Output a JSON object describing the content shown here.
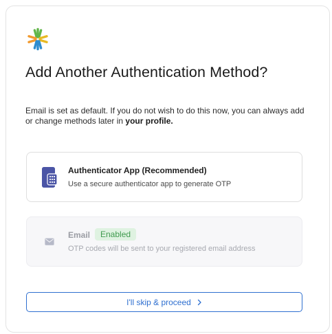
{
  "dialog": {
    "title": "Add Another Authentication Method?",
    "description_prefix": "Email is set as default. If you do not wish to do this now, you can always add or change methods later in ",
    "description_link": "your profile."
  },
  "options": [
    {
      "icon": "authenticator-app-icon",
      "title": "Authenticator App (Recommended)",
      "subtitle": "Use a secure authenticator app to generate OTP"
    },
    {
      "icon": "mail-icon",
      "title": "Email",
      "badge": "Enabled",
      "subtitle": "OTP codes will be sent to your registered email address"
    }
  ],
  "actions": {
    "skip_label": "I'll skip & proceed"
  },
  "colors": {
    "accent": "#2e6fd0",
    "app_icon": "#4b55a6",
    "badge_text": "#3f9a4e",
    "badge_bg": "#dff2e1"
  }
}
